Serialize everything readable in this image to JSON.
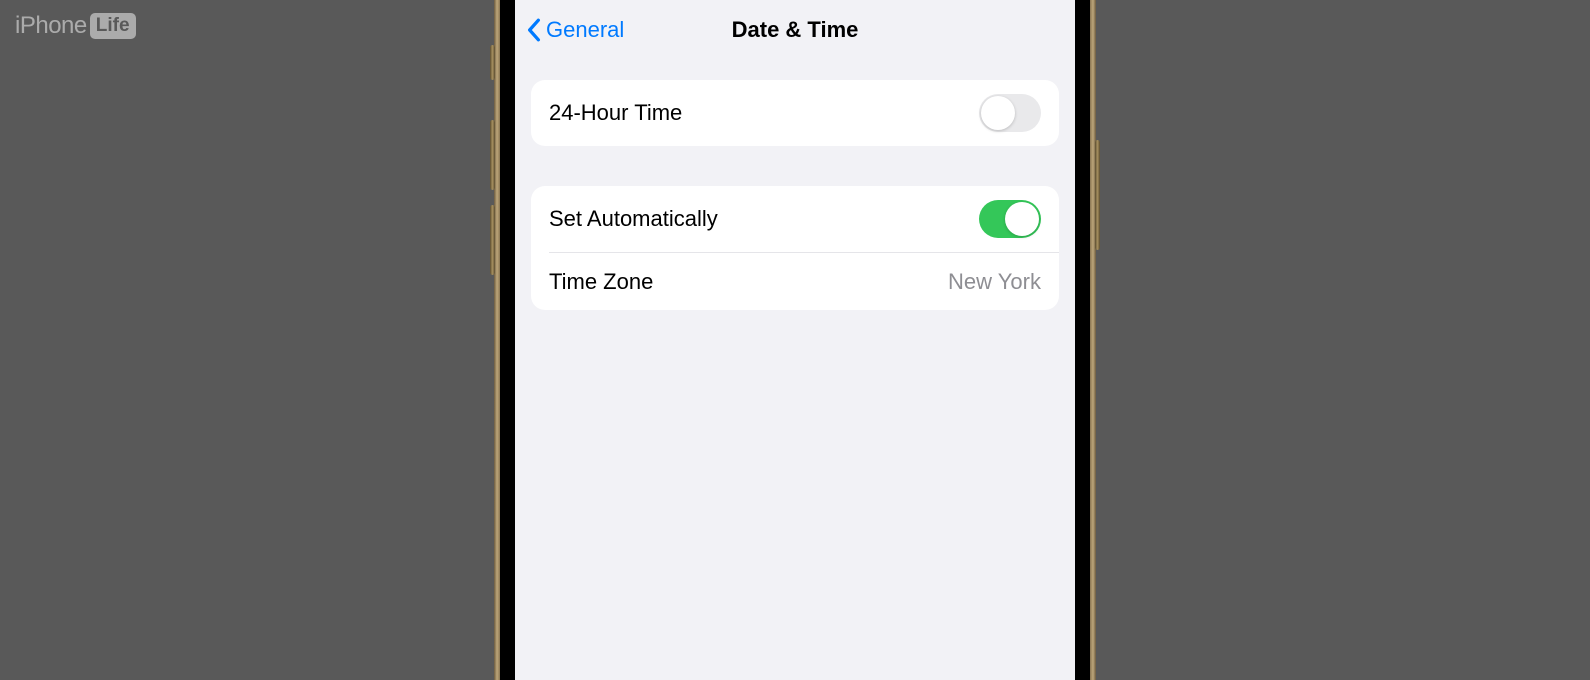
{
  "watermark": {
    "brand_first": "iPhone",
    "brand_second": "Life"
  },
  "nav": {
    "back_label": "General",
    "title": "Date & Time"
  },
  "settings": {
    "group1": {
      "twenty_four_hour_label": "24-Hour Time",
      "twenty_four_hour_on": false
    },
    "group2": {
      "set_automatically_label": "Set Automatically",
      "set_automatically_on": true,
      "time_zone_label": "Time Zone",
      "time_zone_value": "New York"
    }
  },
  "colors": {
    "ios_blue": "#007aff",
    "ios_green": "#34c759",
    "bg_grouped": "#f2f2f6"
  }
}
